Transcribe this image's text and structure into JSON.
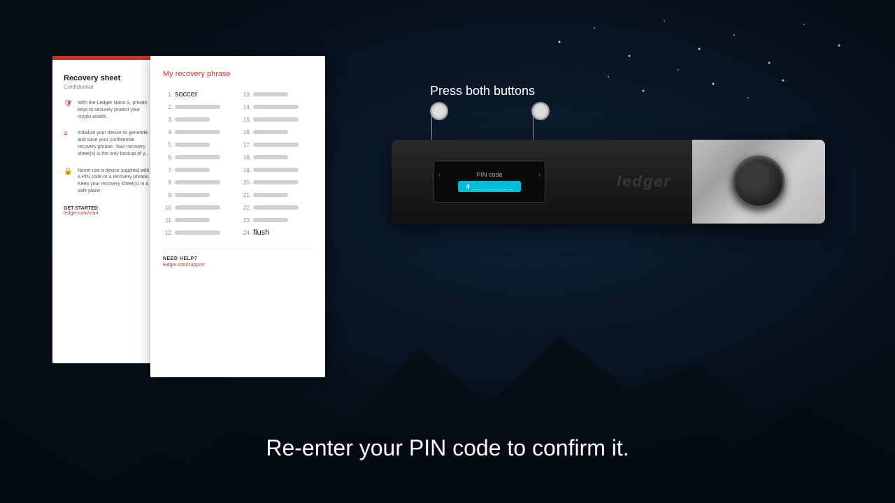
{
  "background": {
    "color": "#0a1520"
  },
  "recovery_sheet_bg": {
    "red_bar": true,
    "title": "Recovery sheet",
    "subtitle": "Confidential",
    "sections": [
      {
        "icon": "shield",
        "text": "With the Ledger Nano S, private keys to securely protect your crypto assets."
      },
      {
        "icon": "list",
        "text": "Initialize your device to generate and save your confidential recovery phrase. Your recovery sheet(s) is the only backup of y..."
      },
      {
        "icon": "lock",
        "text": "Never use a device supplied with a PIN code or a recovery phrase. Keep your recovery sheet(s) in a safe place."
      }
    ],
    "get_started": "GET STARTED",
    "link": "ledger.com/start"
  },
  "recovery_card": {
    "title": "My recovery phrase",
    "words": [
      {
        "num": "1.",
        "word": "soccer",
        "visible": true
      },
      {
        "num": "2.",
        "word": "",
        "visible": false
      },
      {
        "num": "3.",
        "word": "",
        "visible": false
      },
      {
        "num": "4.",
        "word": "",
        "visible": false
      },
      {
        "num": "5.",
        "word": "",
        "visible": false
      },
      {
        "num": "6.",
        "word": "",
        "visible": false
      },
      {
        "num": "7.",
        "word": "",
        "visible": false
      },
      {
        "num": "8.",
        "word": "",
        "visible": false
      },
      {
        "num": "9.",
        "word": "",
        "visible": false
      },
      {
        "num": "10.",
        "word": "",
        "visible": false
      },
      {
        "num": "11.",
        "word": "",
        "visible": false
      },
      {
        "num": "12.",
        "word": "",
        "visible": false
      },
      {
        "num": "13.",
        "word": "",
        "visible": false
      },
      {
        "num": "14.",
        "word": "",
        "visible": false
      },
      {
        "num": "15.",
        "word": "",
        "visible": false
      },
      {
        "num": "16.",
        "word": "",
        "visible": false
      },
      {
        "num": "17.",
        "word": "",
        "visible": false
      },
      {
        "num": "18.",
        "word": "",
        "visible": false
      },
      {
        "num": "19.",
        "word": "",
        "visible": false
      },
      {
        "num": "20.",
        "word": "",
        "visible": false
      },
      {
        "num": "21.",
        "word": "",
        "visible": false
      },
      {
        "num": "22.",
        "word": "",
        "visible": false
      },
      {
        "num": "23.",
        "word": "",
        "visible": false
      },
      {
        "num": "24.",
        "word": "flush",
        "visible": true
      }
    ],
    "need_help_title": "NEED HELP?",
    "need_help_link": "ledger.com/support"
  },
  "device": {
    "screen_label": "PIN code",
    "pin_display": "4 _ _ _ _ _ _ _ _",
    "left_button_label": "left button",
    "right_button_label": "right button",
    "logo": "ledger"
  },
  "press_buttons": {
    "label": "Press both buttons"
  },
  "subtitle": {
    "text": "Re-enter your PIN code to confirm it."
  }
}
